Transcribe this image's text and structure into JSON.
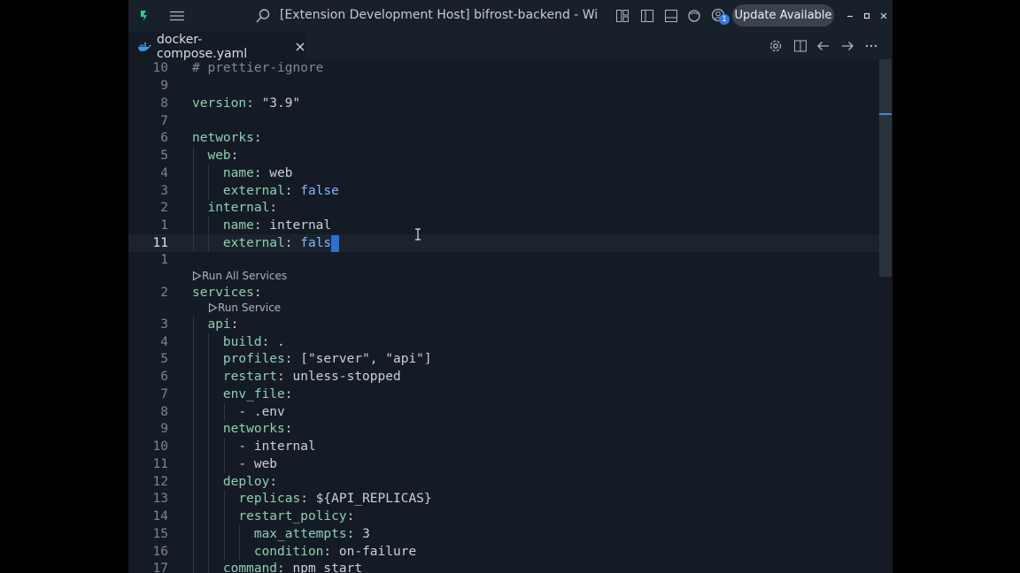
{
  "titlebar": {
    "title": "[Extension Development Host] bifrost-backend - Winds...",
    "update_label": "Update Available",
    "notification_count": "1",
    "icons": [
      "app-logo-icon",
      "menu-icon",
      "search-icon",
      "layout-icon",
      "toggle-sidebar-icon",
      "toggle-panel-icon",
      "copilot-icon",
      "accounts-icon",
      "minimize-icon",
      "maximize-icon",
      "close-icon"
    ]
  },
  "tabs": [
    {
      "label": "docker-compose.yaml",
      "icon": "docker-whale-icon"
    }
  ],
  "editor_actions": [
    "gear-icon",
    "split-editor-icon",
    "arrow-left-icon",
    "arrow-right-icon",
    "more-icon"
  ],
  "editor": {
    "lines": [
      {
        "n": "10",
        "text": "# prettier-ignore"
      },
      {
        "n": "9",
        "text": ""
      },
      {
        "n": "8",
        "text": "version: \"3.9\""
      },
      {
        "n": "7",
        "text": ""
      },
      {
        "n": "6",
        "text": "networks:"
      },
      {
        "n": "5",
        "text": "  web:"
      },
      {
        "n": "4",
        "text": "    name: web"
      },
      {
        "n": "3",
        "text": "    external: false"
      },
      {
        "n": "2",
        "text": "  internal:"
      },
      {
        "n": "1",
        "text": "    name: internal"
      },
      {
        "n": "11",
        "text": "    external: false",
        "current": true
      },
      {
        "n": "1",
        "text": ""
      },
      {
        "n": "2",
        "text": "services:"
      },
      {
        "n": "3",
        "text": "  api:"
      },
      {
        "n": "4",
        "text": "    build: ."
      },
      {
        "n": "5",
        "text": "    profiles: [\"server\", \"api\"]"
      },
      {
        "n": "6",
        "text": "    restart: unless-stopped"
      },
      {
        "n": "7",
        "text": "    env_file:"
      },
      {
        "n": "8",
        "text": "      - .env"
      },
      {
        "n": "9",
        "text": "    networks:"
      },
      {
        "n": "10",
        "text": "      - internal"
      },
      {
        "n": "11",
        "text": "      - web"
      },
      {
        "n": "12",
        "text": "    deploy:"
      },
      {
        "n": "13",
        "text": "      replicas: ${API_REPLICAS}"
      },
      {
        "n": "14",
        "text": "      restart_policy:"
      },
      {
        "n": "15",
        "text": "        max_attempts: 3"
      },
      {
        "n": "16",
        "text": "        condition: on-failure"
      },
      {
        "n": "17",
        "text": "    command: npm start"
      }
    ],
    "codelens": {
      "run_all": "Run All Services",
      "run_service": "Run Service"
    },
    "colors": {
      "key": "#8fd0b0",
      "comment": "#7f8995",
      "bool": "#7fb8ff",
      "selection": "#2d6fd3"
    }
  }
}
